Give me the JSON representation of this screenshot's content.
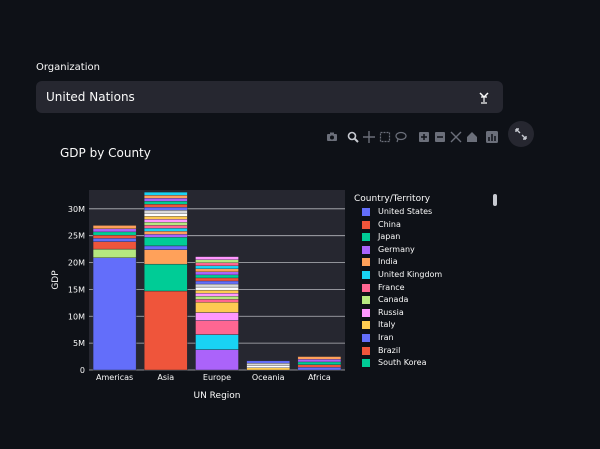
{
  "organization": {
    "label": "Organization",
    "value": "United Nations"
  },
  "modebar_icons": [
    "camera-icon",
    "zoom-icon",
    "pan-icon",
    "box-select-icon",
    "lasso-icon",
    "zoom-in-icon",
    "zoom-out-icon",
    "autoscale-icon",
    "home-icon",
    "plotly-logo-icon"
  ],
  "chart_data": {
    "type": "bar",
    "stacked": true,
    "title": "GDP by County",
    "xlabel": "UN Region",
    "ylabel": "GDP",
    "categories": [
      "Americas",
      "Asia",
      "Europe",
      "Oceania",
      "Africa"
    ],
    "yticks": [
      "0",
      "5M",
      "10M",
      "15M",
      "20M",
      "25M",
      "30M"
    ],
    "ytick_values": [
      0,
      5000000,
      10000000,
      15000000,
      20000000,
      25000000,
      30000000
    ],
    "ylim": [
      0,
      33500000
    ],
    "grid": true,
    "legend_title": "Country/Territory",
    "legend_position": "right",
    "series": [
      {
        "name": "United States",
        "color": "#636efa",
        "values": [
          20900000,
          0,
          0,
          0,
          0
        ]
      },
      {
        "name": "China",
        "color": "#ef553b",
        "values": [
          0,
          14700000,
          0,
          0,
          0
        ]
      },
      {
        "name": "Japan",
        "color": "#00cc96",
        "values": [
          0,
          5000000,
          0,
          0,
          0
        ]
      },
      {
        "name": "Germany",
        "color": "#ab63fa",
        "values": [
          0,
          0,
          3800000,
          0,
          0
        ]
      },
      {
        "name": "India",
        "color": "#ffa15a",
        "values": [
          0,
          2700000,
          0,
          0,
          0
        ]
      },
      {
        "name": "United Kingdom",
        "color": "#19d3f3",
        "values": [
          0,
          0,
          2800000,
          0,
          0
        ]
      },
      {
        "name": "France",
        "color": "#ff6692",
        "values": [
          0,
          0,
          2600000,
          0,
          0
        ]
      },
      {
        "name": "Canada",
        "color": "#b6e880",
        "values": [
          1600000,
          0,
          0,
          0,
          0
        ]
      },
      {
        "name": "Russia",
        "color": "#ff97ff",
        "values": [
          0,
          0,
          1500000,
          0,
          0
        ]
      },
      {
        "name": "Italy",
        "color": "#fecb52",
        "values": [
          0,
          0,
          1900000,
          0,
          0
        ]
      },
      {
        "name": "Iran",
        "color": "#636efa",
        "values": [
          0,
          700000,
          0,
          0,
          0
        ]
      },
      {
        "name": "Brazil",
        "color": "#ef553b",
        "values": [
          1400000,
          0,
          0,
          0,
          0
        ]
      },
      {
        "name": "South Korea",
        "color": "#00cc96",
        "values": [
          0,
          1600000,
          0,
          0,
          0
        ]
      }
    ],
    "other_stack_remainder": [
      3000000,
      8400000,
      8500000,
      1700000,
      2500000
    ],
    "other_colors": [
      "#636efa",
      "#ef553b",
      "#00cc96",
      "#ab63fa",
      "#ffa15a",
      "#19d3f3",
      "#ff6692",
      "#b6e880",
      "#ff97ff",
      "#fecb52",
      "#ffffff",
      "#d9d9d9"
    ]
  }
}
